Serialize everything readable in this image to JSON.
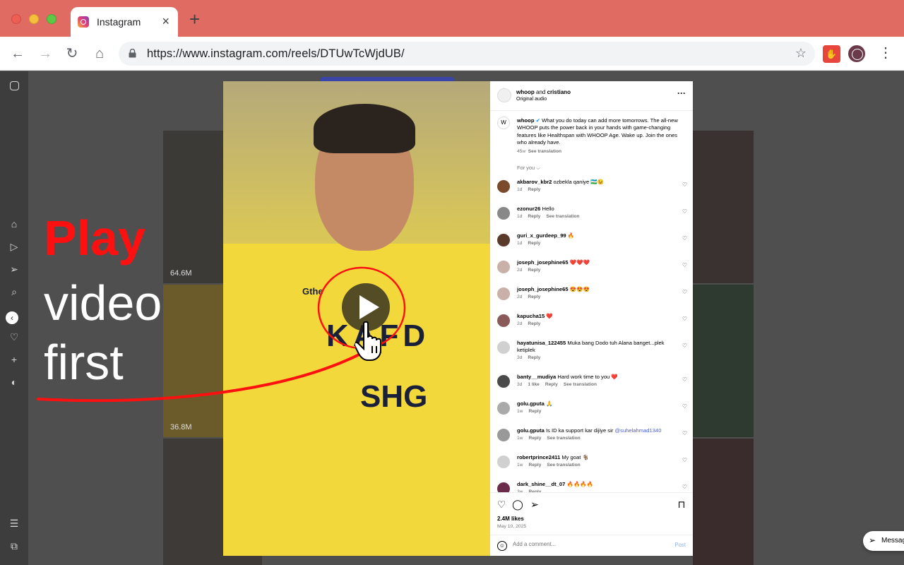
{
  "browser": {
    "tab_title": "Instagram",
    "tab_close": "×",
    "new_tab": "+",
    "url": "https://www.instagram.com/reels/DTUwTcWjdUB/",
    "back": "←",
    "forward": "→",
    "reload": "↻",
    "home": "⌂",
    "bookmark": "☆",
    "menu": "⋮"
  },
  "overlay": {
    "line1": "Play",
    "line2": "video",
    "line3": "first",
    "accent_color": "#ff1010"
  },
  "grid": {
    "counts": [
      "64.6M",
      "36.8M"
    ]
  },
  "reel": {
    "sponsor_top": "Gthe",
    "sponsor_mid": "KAFD",
    "sponsor_bottom": "SHG"
  },
  "panel": {
    "header_user1": "whoop",
    "header_and": "and",
    "header_user2": "cristiano",
    "header_audio": "Original audio",
    "more": "···",
    "caption_user": "whoop",
    "caption_text": "What you do today can add more tomorrows. The all-new WHOOP puts the power back in your hands with game-changing features like Healthspan with WHOOP Age. Wake up. Join the ones who already have.",
    "caption_age": "45w",
    "caption_translate": "See translation",
    "for_you": "For you",
    "comments": [
      {
        "user": "akbarov_kbr2",
        "text": "ozbekla qaniye 🇺🇿😉",
        "age": "1d",
        "actions": [
          "Reply"
        ]
      },
      {
        "user": "ezonur26",
        "text": "Hello",
        "age": "1d",
        "actions": [
          "Reply",
          "See translation"
        ]
      },
      {
        "user": "guri_x_gurdeep_99",
        "text": "🔥",
        "age": "1d",
        "actions": [
          "Reply"
        ]
      },
      {
        "user": "joseph_josephine65",
        "text": "❤️❤️❤️",
        "age": "2d",
        "actions": [
          "Reply"
        ]
      },
      {
        "user": "joseph_josephine65",
        "text": "😍😍😍",
        "age": "2d",
        "actions": [
          "Reply"
        ]
      },
      {
        "user": "kapucha15",
        "text": "❤️",
        "age": "2d",
        "actions": [
          "Reply"
        ]
      },
      {
        "user": "hayatunisa_122455",
        "text": "Muka bang Dodo tuh Alana banget...plek ketiplek",
        "age": "3d",
        "actions": [
          "Reply"
        ]
      },
      {
        "user": "banty__mudiya",
        "text": "Hard work time to you ❤️",
        "age": "3d",
        "actions": [
          "1 like",
          "Reply",
          "See translation"
        ]
      },
      {
        "user": "golu.gputa",
        "text": "🙏",
        "age": "1w",
        "actions": [
          "Reply"
        ]
      },
      {
        "user": "golu.gputa",
        "text": "Is ID ka support kar dijiye sir",
        "mention": "@suhelahmad1340",
        "age": "1w",
        "actions": [
          "Reply",
          "See translation"
        ]
      },
      {
        "user": "robertprince2411",
        "text": "My goat 🐐",
        "age": "1w",
        "actions": [
          "Reply",
          "See translation"
        ]
      },
      {
        "user": "dark_shine__dt_07",
        "text": "🔥🔥🔥🔥",
        "age": "3w",
        "actions": [
          "Reply"
        ]
      }
    ],
    "likes": "2.4M likes",
    "date": "May 10, 2025",
    "comment_placeholder": "Add a comment...",
    "post": "Post"
  },
  "messages_label": "Messag"
}
